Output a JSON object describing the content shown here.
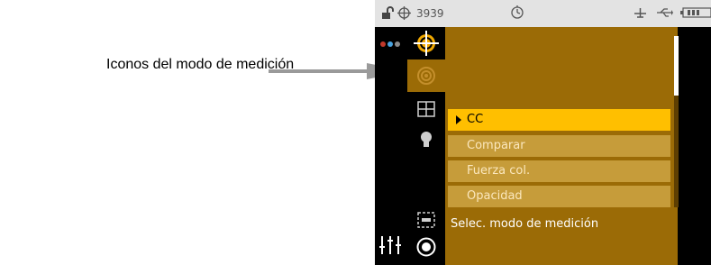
{
  "callout": {
    "label": "Iconos del modo de medición"
  },
  "status_bar": {
    "lock_icon": "lock-open-icon",
    "target_icon": "crosshair-icon",
    "number": "3939",
    "center_icon": "clock-target-icon",
    "right_icons": [
      "plane-icon",
      "usb-icon",
      "battery-icon"
    ]
  },
  "measure_modes": [
    "bullseye-target-icon",
    "ring-target-icon",
    "grid-icon",
    "bulb-icon",
    "dashed-square-icon",
    "record-icon"
  ],
  "menu": {
    "items": [
      "CC",
      "Comparar",
      "Fuerza col.",
      "Opacidad"
    ],
    "selected_index": 0,
    "hint": "Selec. modo de medición"
  },
  "scroll": {
    "position": 0.0
  },
  "colors": {
    "panel": "#9b6b06",
    "item": "#c69c3a",
    "item_selected": "#ffbf00",
    "dots": [
      "#c0392b",
      "#4aa3df",
      "#8a8a8a"
    ]
  }
}
